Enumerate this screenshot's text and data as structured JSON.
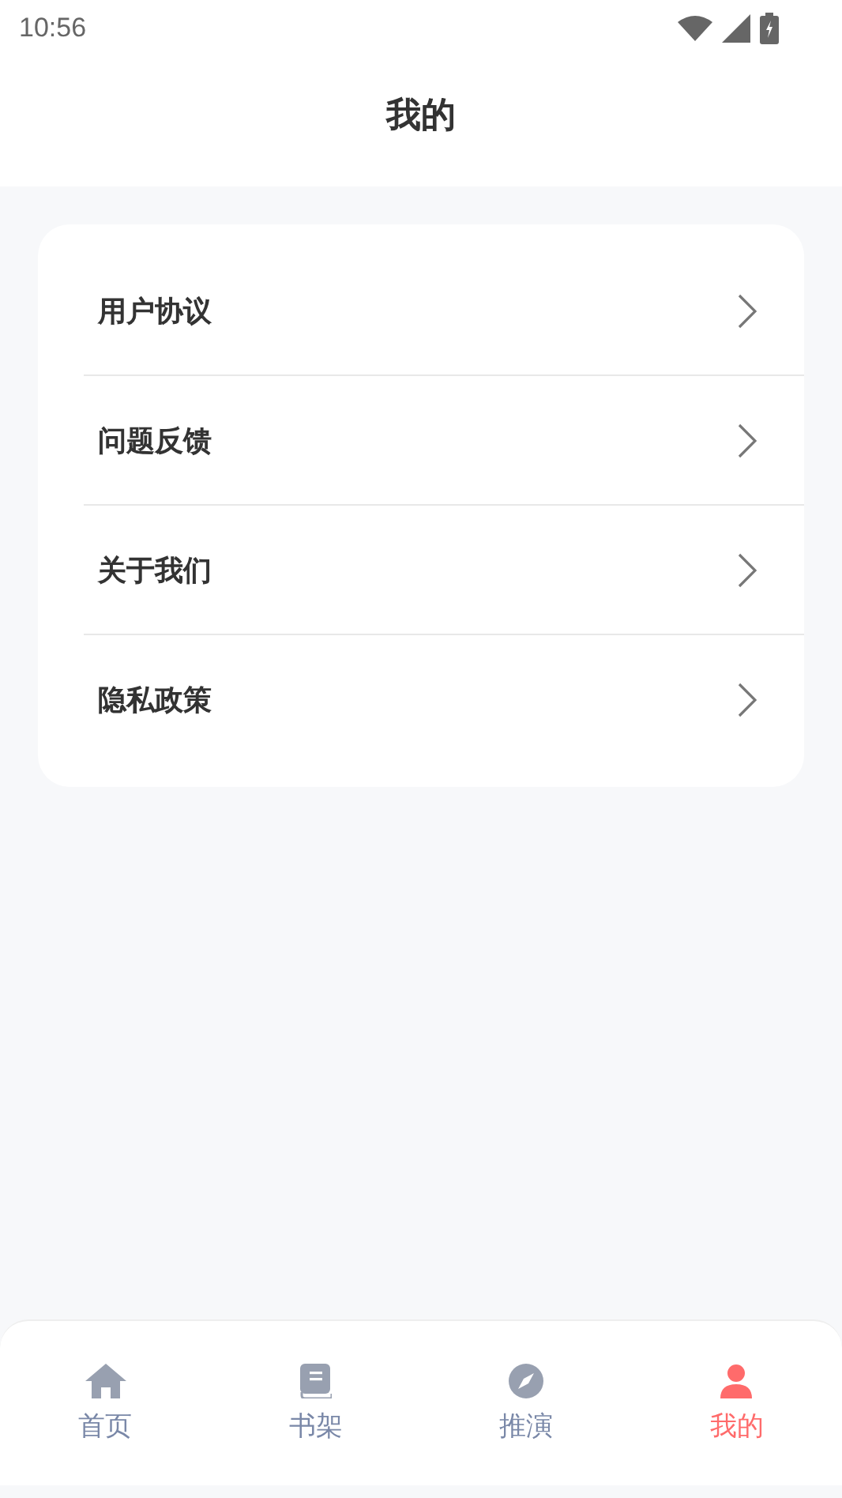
{
  "status_bar": {
    "time": "10:56"
  },
  "header": {
    "title": "我的"
  },
  "menu": {
    "items": [
      {
        "label": "用户协议"
      },
      {
        "label": "问题反馈"
      },
      {
        "label": "关于我们"
      },
      {
        "label": "隐私政策"
      }
    ]
  },
  "tab_bar": {
    "tabs": [
      {
        "kind": "home",
        "label": "首页",
        "selected": false
      },
      {
        "kind": "book",
        "label": "书架",
        "selected": false
      },
      {
        "kind": "compass",
        "label": "推演",
        "selected": false
      },
      {
        "kind": "person",
        "label": "我的",
        "selected": true
      }
    ]
  }
}
